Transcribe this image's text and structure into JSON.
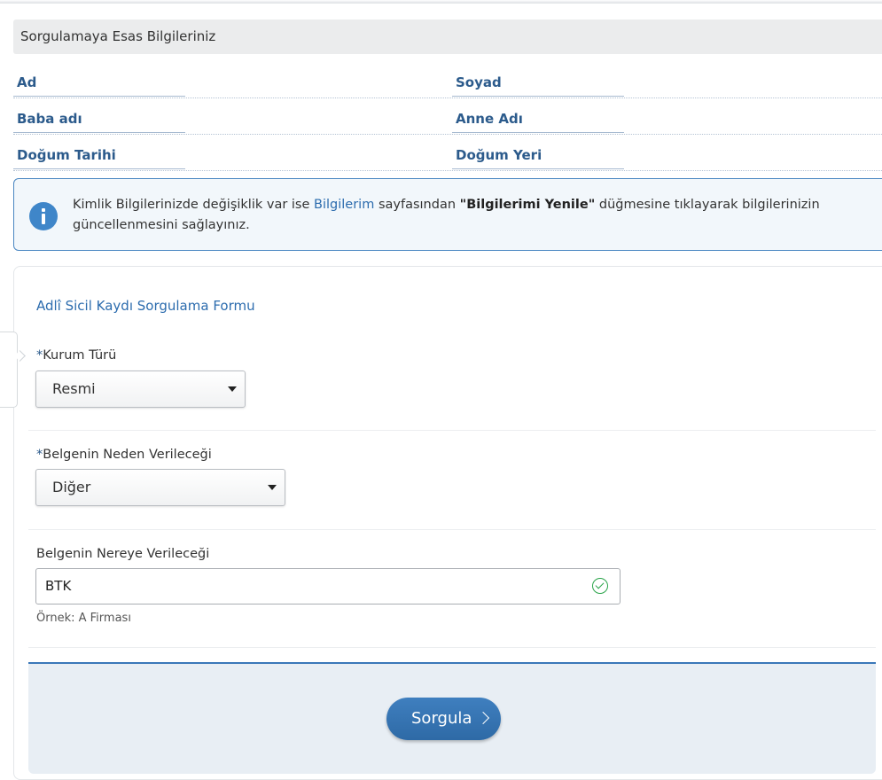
{
  "info_section": {
    "title": "Sorgulamaya Esas Bilgileriniz",
    "fields": [
      {
        "label": "Ad"
      },
      {
        "label": "Soyad"
      },
      {
        "label": "Baba adı"
      },
      {
        "label": "Anne Adı"
      },
      {
        "label": "Doğum Tarihi"
      },
      {
        "label": "Doğum Yeri"
      }
    ]
  },
  "alert": {
    "text_before": "Kimlik Bilgilerinizde değişiklik var ise ",
    "link_text": "Bilgilerim",
    "text_middle": " sayfasından ",
    "bold_text": "\"Bilgilerimi Yenile\"",
    "text_after": " düğmesine tıklayarak bilgilerinizin güncellenmesini sağlayınız."
  },
  "form": {
    "title": "Adlî Sicil Kaydı Sorgulama Formu",
    "required_marker": "*",
    "kurum_turu": {
      "label": "Kurum Türü",
      "value": "Resmi"
    },
    "neden": {
      "label": "Belgenin Neden Verileceği",
      "value": "Diğer"
    },
    "nereye": {
      "label": "Belgenin Nereye Verileceği",
      "value": "BTK",
      "hint": "Örnek: A Firması"
    },
    "submit_label": "Sorgula"
  },
  "colors": {
    "accent": "#2c6cae",
    "label_blue": "#2c5b8c",
    "info_icon": "#3f86c9",
    "success": "#2aa44a",
    "footer_bg": "#e8eef4"
  },
  "icons": {
    "alert": "info-icon",
    "select_caret": "caret-down-icon",
    "valid": "check-circle-icon",
    "submit": "chevron-right-icon",
    "side_tab": "chevron-right-icon"
  }
}
